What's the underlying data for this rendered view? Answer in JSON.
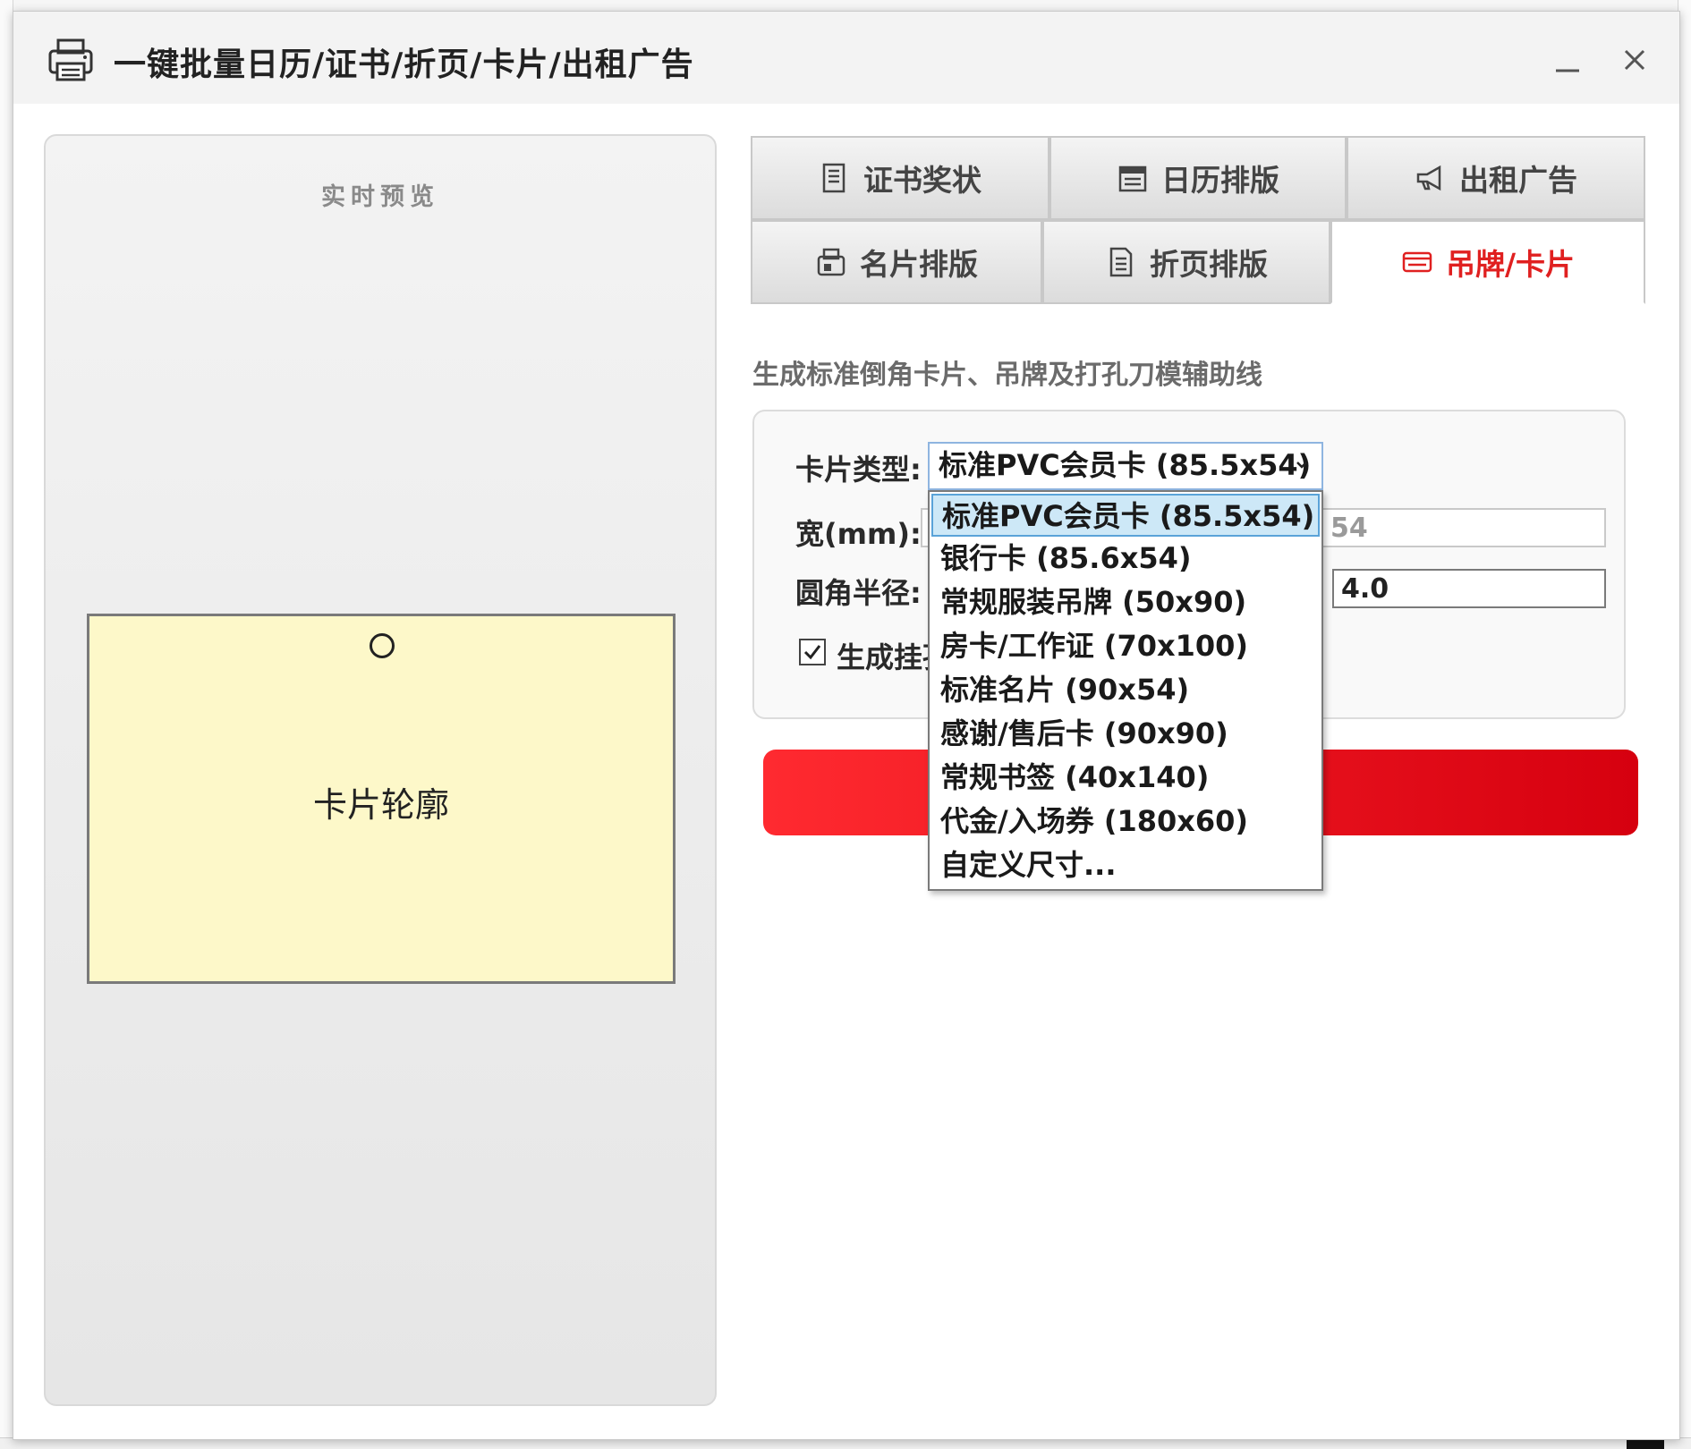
{
  "window": {
    "title": "一键批量日历/证书/折页/卡片/出租广告",
    "icon": "printer-icon",
    "minimize_icon": "minimize-icon",
    "close_icon": "close-icon"
  },
  "preview": {
    "title": "实时预览",
    "card_label": "卡片轮廓"
  },
  "tabs": [
    {
      "label": "证书奖状",
      "icon": "certificate-icon",
      "active": false
    },
    {
      "label": "日历排版",
      "icon": "calendar-icon",
      "active": false
    },
    {
      "label": "出租广告",
      "icon": "megaphone-icon",
      "active": false
    },
    {
      "label": "名片排版",
      "icon": "business-card-icon",
      "active": false
    },
    {
      "label": "折页排版",
      "icon": "document-icon",
      "active": false
    },
    {
      "label": "吊牌/卡片",
      "icon": "card-icon",
      "active": true
    }
  ],
  "panel": {
    "subtitle": "生成标准倒角卡片、吊牌及打孔刀模辅助线",
    "card_type_label": "卡片类型:",
    "card_type_value": "标准PVC会员卡 (85.5x54)",
    "width_label": "宽(mm):",
    "height_value": "54",
    "radius_label": "圆角半径:",
    "radius_value": "4.0",
    "checkbox_label": "生成挂孔",
    "checkbox_checked": true,
    "accent_color": "#e02020"
  },
  "dropdown": {
    "options": [
      "标准PVC会员卡 (85.5x54)",
      "银行卡 (85.6x54)",
      "常规服装吊牌 (50x90)",
      "房卡/工作证 (70x100)",
      "标准名片 (90x54)",
      "感谢/售后卡 (90x90)",
      "常规书签 (40x140)",
      "代金/入场券 (180x60)",
      "自定义尺寸..."
    ],
    "selected_index": 0
  }
}
